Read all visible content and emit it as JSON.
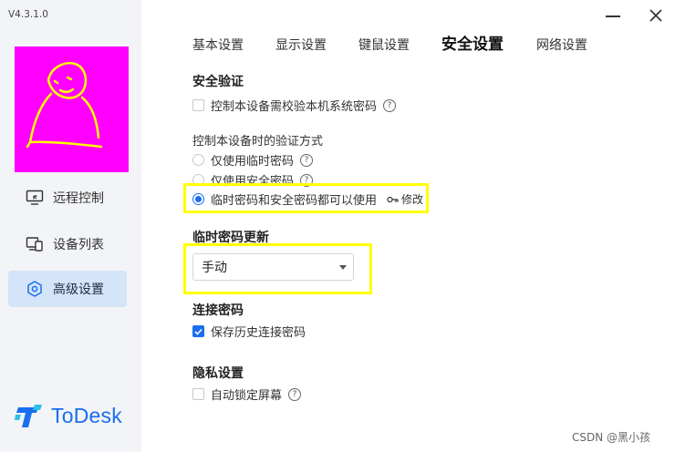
{
  "app": {
    "version": "V4.3.1.0",
    "brand_name": "ToDesk",
    "brand_color": "#1a6ef0",
    "avatar_bg": "#ff00ff"
  },
  "sidebar": {
    "items": [
      {
        "label": "远程控制",
        "icon": "remote-control-icon",
        "active": false
      },
      {
        "label": "设备列表",
        "icon": "device-list-icon",
        "active": false
      },
      {
        "label": "高级设置",
        "icon": "hex-gear-icon",
        "active": true
      }
    ]
  },
  "tabs": [
    {
      "label": "基本设置",
      "active": false
    },
    {
      "label": "显示设置",
      "active": false
    },
    {
      "label": "键鼠设置",
      "active": false
    },
    {
      "label": "安全设置",
      "active": true
    },
    {
      "label": "网络设置",
      "active": false
    }
  ],
  "security": {
    "section_title": "安全验证",
    "verify_system_password": {
      "label": "控制本设备需校验本机系统密码",
      "checked": false
    },
    "method_title": "控制本设备时的验证方式",
    "methods": [
      {
        "label": "仅使用临时密码",
        "checked": false
      },
      {
        "label": "仅使用安全密码",
        "checked": false
      },
      {
        "label": "临时密码和安全密码都可以使用",
        "checked": true
      }
    ],
    "modify_label": "修改",
    "help_glyph": "?"
  },
  "temp_password": {
    "title": "临时密码更新",
    "selected": "手动"
  },
  "connection_password": {
    "title": "连接密码",
    "save_history": {
      "label": "保存历史连接密码",
      "checked": true
    }
  },
  "privacy": {
    "title": "隐私设置",
    "auto_lock": {
      "label": "自动锁定屏幕",
      "checked": false
    }
  },
  "annotations": {
    "highlight_color": "#ffff00"
  },
  "watermark": "CSDN @黑小孩"
}
